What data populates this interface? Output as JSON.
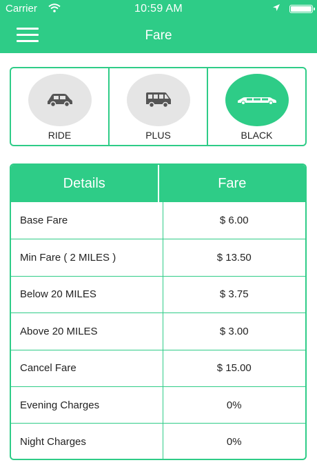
{
  "status_bar": {
    "carrier": "Carrier",
    "time": "10:59 AM"
  },
  "header": {
    "title": "Fare"
  },
  "vehicles": [
    {
      "label": "RIDE",
      "icon": "car-icon",
      "selected": false
    },
    {
      "label": "PLUS",
      "icon": "van-icon",
      "selected": false
    },
    {
      "label": "BLACK",
      "icon": "limo-icon",
      "selected": true
    }
  ],
  "table": {
    "headers": [
      "Details",
      "Fare"
    ],
    "rows": [
      {
        "detail": "Base Fare",
        "fare": "$ 6.00"
      },
      {
        "detail": "Min Fare ( 2 MILES )",
        "fare": "$ 13.50"
      },
      {
        "detail": "Below 20 MILES",
        "fare": "$ 3.75"
      },
      {
        "detail": "Above 20 MILES",
        "fare": "$ 3.00"
      },
      {
        "detail": "Cancel Fare",
        "fare": "$ 15.00"
      },
      {
        "detail": "Evening Charges",
        "fare": "0%"
      },
      {
        "detail": "Night Charges",
        "fare": "0%"
      }
    ]
  },
  "colors": {
    "accent": "#2ecc87",
    "unselected_circle": "#e5e5e5",
    "icon_dark": "#555555"
  }
}
